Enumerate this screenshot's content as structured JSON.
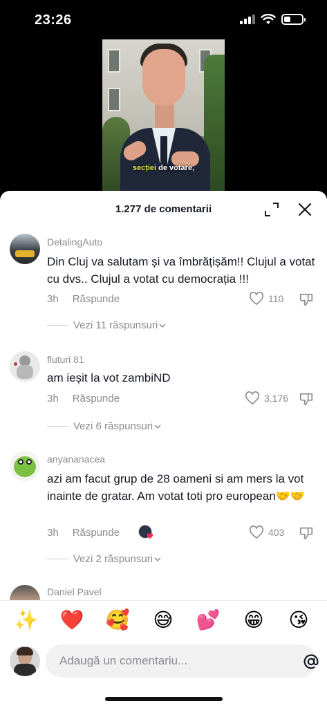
{
  "status_bar": {
    "time": "23:26"
  },
  "video": {
    "caption_highlight": "secției",
    "caption_rest": " de votare,"
  },
  "sheet": {
    "title": "1.277 de comentarii"
  },
  "comments": [
    {
      "username": "DetalingAuto",
      "text": "Din Cluj va salutam și va îmbrățișăm!! Clujul a votat cu dvs.. Clujul a votat cu democrația !!!",
      "time": "3h",
      "reply_label": "Răspunde",
      "likes": "110",
      "view_replies": "Vezi 11 răspunsuri"
    },
    {
      "username": "fluturi 81",
      "text": "am ieșit la vot zambiND",
      "time": "3h",
      "reply_label": "Răspunde",
      "likes": "3.176",
      "view_replies": "Vezi 6 răspunsuri"
    },
    {
      "username": "anyananacea",
      "text": "azi am facut grup de 28 oameni si am mers la vot inainte de gratar. Am votat toti pro european🤝🤝",
      "time": "3h",
      "reply_label": "Răspunde",
      "likes": "403",
      "view_replies": "Vezi 2 răspunsuri"
    },
    {
      "username": "Daniel Pavel"
    }
  ],
  "emoji_bar": [
    "✨",
    "❤️",
    "🥰",
    "😅",
    "💕",
    "😁",
    "😘"
  ],
  "input": {
    "placeholder": "Adaugă un comentariu..."
  },
  "colors": {
    "text_primary": "#161823",
    "text_secondary": "#8a8b91",
    "sheet_bg": "#ffffff",
    "input_bg": "#f1f1f2"
  }
}
